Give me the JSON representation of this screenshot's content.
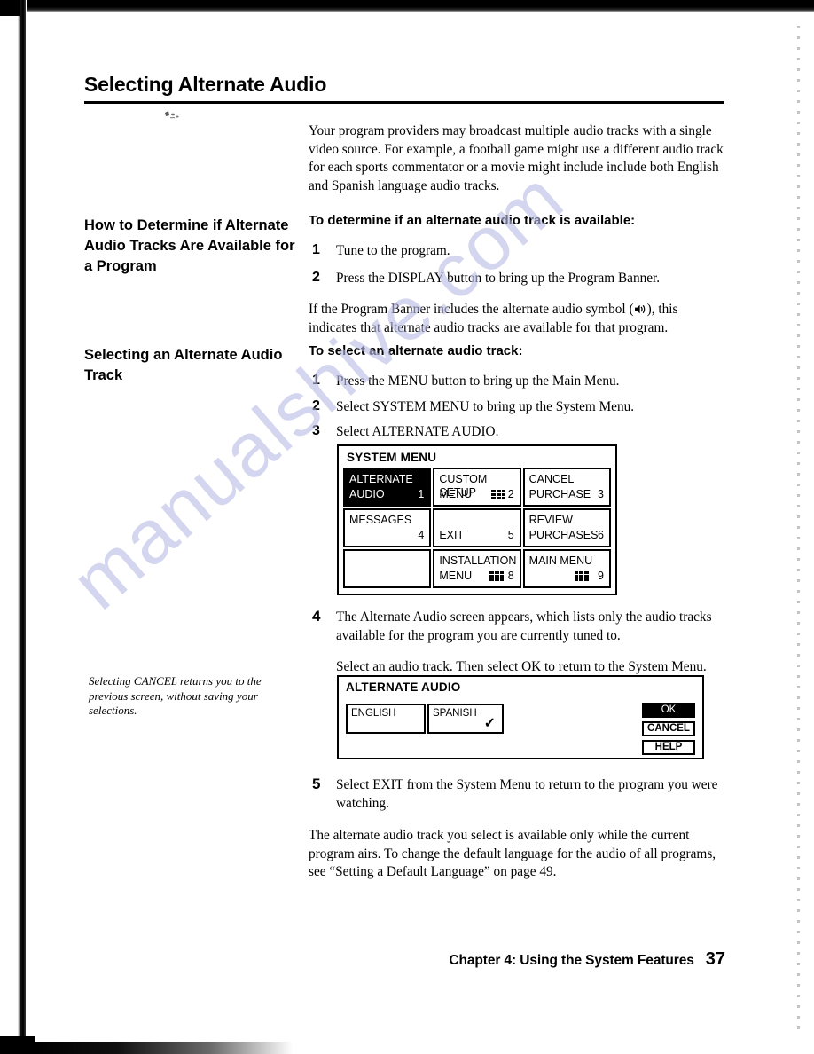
{
  "page": {
    "title": "Selecting Alternate Audio",
    "intro_paragraph": "Your program providers may broadcast multiple audio tracks with a single video source. For example, a football game might use a different audio track for each sports commentator or a movie might include include both English and Spanish language audio tracks.",
    "watermark": "manualshive.com"
  },
  "section_determine": {
    "side_heading": "How to Determine if Alternate Audio Tracks Are Available for a Program",
    "sub_heading": "To determine if an alternate audio track is available:",
    "steps": [
      {
        "num": "1",
        "text": "Tune to the program."
      },
      {
        "num": "2",
        "text": "Press the DISPLAY button to bring up the Program Banner."
      }
    ],
    "note_before_symbol": "If the Program Banner includes the alternate audio symbol (",
    "note_after_symbol": "), this indicates that alternate audio tracks are available for that program.",
    "symbol_icon": "speaker-icon"
  },
  "section_select": {
    "side_heading": "Selecting an Alternate Audio Track",
    "sub_heading": "To select an alternate audio track:",
    "steps": [
      {
        "num": "1",
        "text": "Press the MENU button to bring up the Main Menu."
      },
      {
        "num": "2",
        "text": "Select SYSTEM MENU to bring up the System Menu."
      },
      {
        "num": "3",
        "text": "Select ALTERNATE AUDIO."
      },
      {
        "num": "4",
        "text": "The Alternate Audio screen appears, which lists only the audio tracks available for the program you are currently tuned to."
      },
      {
        "num": "5",
        "text": "Select EXIT from the System Menu to return to the program you were watching."
      }
    ],
    "step4_followup": "Select an audio track. Then select OK to return to the System Menu.",
    "side_note": "Selecting CANCEL returns you to the previous screen, without saving your selections.",
    "closing_paragraph": "The alternate audio track you select is available only while the current program airs. To change the default language for the audio of all programs, see “Setting a Default Language” on page 49."
  },
  "system_menu_screen": {
    "title": "SYSTEM MENU",
    "cells": [
      {
        "line1": "ALTERNATE",
        "line2": "AUDIO",
        "key": "1",
        "highlight": true,
        "icon": ""
      },
      {
        "line1": "CUSTOM SETUP",
        "line2": "MENU",
        "key": "2",
        "highlight": false,
        "icon": "grid-icon"
      },
      {
        "line1": "CANCEL",
        "line2": "PURCHASE",
        "key": "3",
        "highlight": false,
        "icon": ""
      },
      {
        "line1": "MESSAGES",
        "line2": "",
        "key": "4",
        "highlight": false,
        "icon": ""
      },
      {
        "line1": "",
        "line2": "EXIT",
        "key": "5",
        "highlight": false,
        "icon": ""
      },
      {
        "line1": "REVIEW",
        "line2": "PURCHASES",
        "key": "6",
        "highlight": false,
        "icon": ""
      },
      {
        "line1": "",
        "line2": "",
        "key": "",
        "highlight": false,
        "icon": ""
      },
      {
        "line1": "INSTALLATION",
        "line2": "MENU",
        "key": "8",
        "highlight": false,
        "icon": "grid-icon"
      },
      {
        "line1": "MAIN MENU",
        "line2": "",
        "key": "9",
        "highlight": false,
        "icon": "grid-icon"
      }
    ]
  },
  "alternate_audio_screen": {
    "title": "ALTERNATE AUDIO",
    "tracks": [
      {
        "label": "ENGLISH",
        "selected": false
      },
      {
        "label": "SPANISH",
        "selected": true
      }
    ],
    "check_glyph": "✓",
    "buttons": [
      {
        "label": "OK",
        "primary": true
      },
      {
        "label": "CANCEL",
        "primary": false
      },
      {
        "label": "HELP",
        "primary": false
      }
    ]
  },
  "footer": {
    "chapter": "Chapter 4: Using the System Features",
    "page_number": "37"
  }
}
